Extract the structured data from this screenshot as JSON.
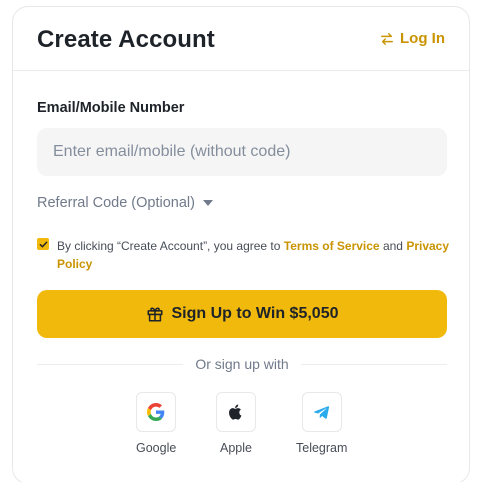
{
  "header": {
    "title": "Create Account",
    "login_label": "Log In"
  },
  "form": {
    "email_label": "Email/Mobile Number",
    "email_placeholder": "Enter email/mobile (without code)",
    "email_value": "",
    "referral_label": "Referral Code (Optional)",
    "agree_prefix": "By clicking “Create Account”, you agree to ",
    "terms_label": "Terms of Service",
    "agree_and": " and ",
    "privacy_label": "Privacy Policy",
    "agree_checked": true,
    "signup_label": "Sign Up to Win $5,050"
  },
  "social": {
    "divider_text": "Or sign up with",
    "providers": [
      {
        "name": "Google",
        "icon": "google-icon"
      },
      {
        "name": "Apple",
        "icon": "apple-icon"
      },
      {
        "name": "Telegram",
        "icon": "telegram-icon"
      }
    ]
  },
  "colors": {
    "accent": "#f0b90b",
    "link": "#c99400",
    "text": "#1e2329",
    "muted": "#707a8a",
    "input_bg": "#f5f5f5"
  }
}
